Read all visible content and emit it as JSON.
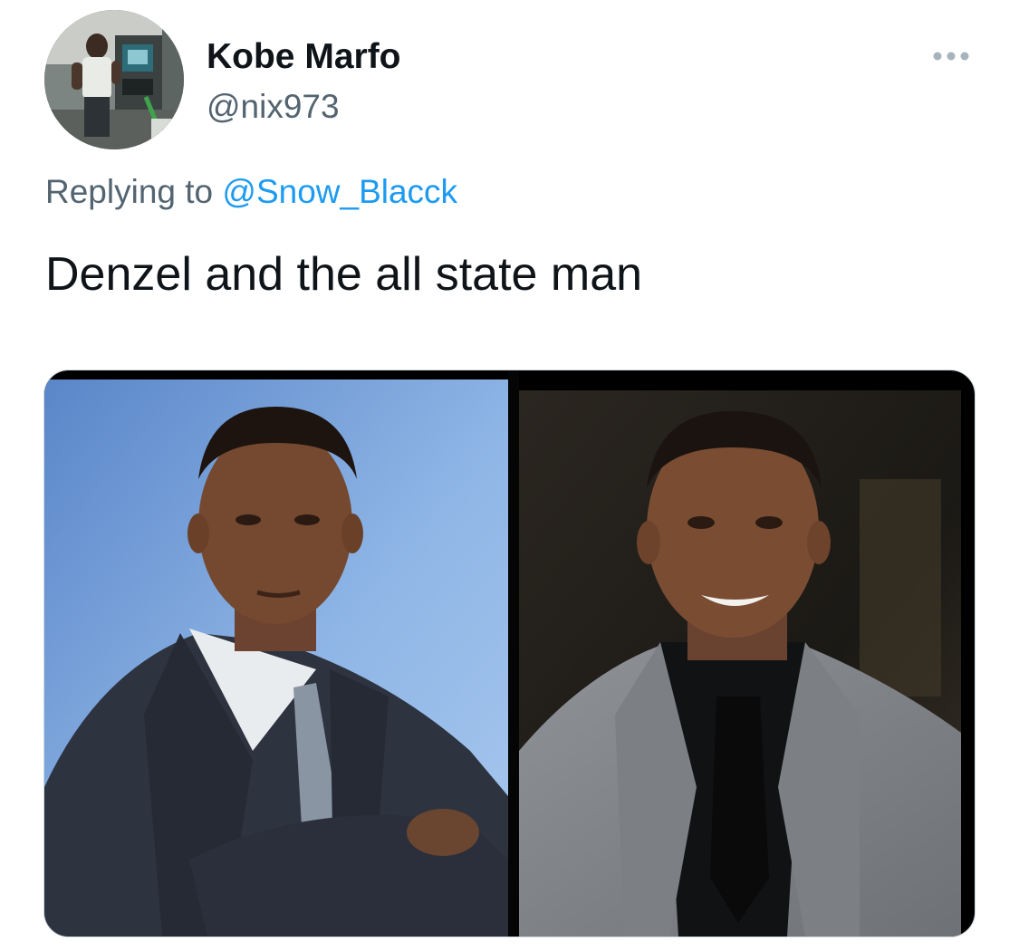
{
  "tweet": {
    "author": {
      "display_name": "Kobe Marfo",
      "handle": "@nix973",
      "avatar_icon": "user-avatar-photo"
    },
    "more_icon": "more-horizontal-icon",
    "replying_to": {
      "prefix": "Replying to",
      "mention": "@Snow_Blacck"
    },
    "text": "Denzel and the all state man",
    "media": {
      "type": "image",
      "panels": 2
    }
  },
  "colors": {
    "text_primary": "#0f1419",
    "text_secondary": "#536471",
    "link": "#1d9bf0",
    "background": "#ffffff"
  }
}
